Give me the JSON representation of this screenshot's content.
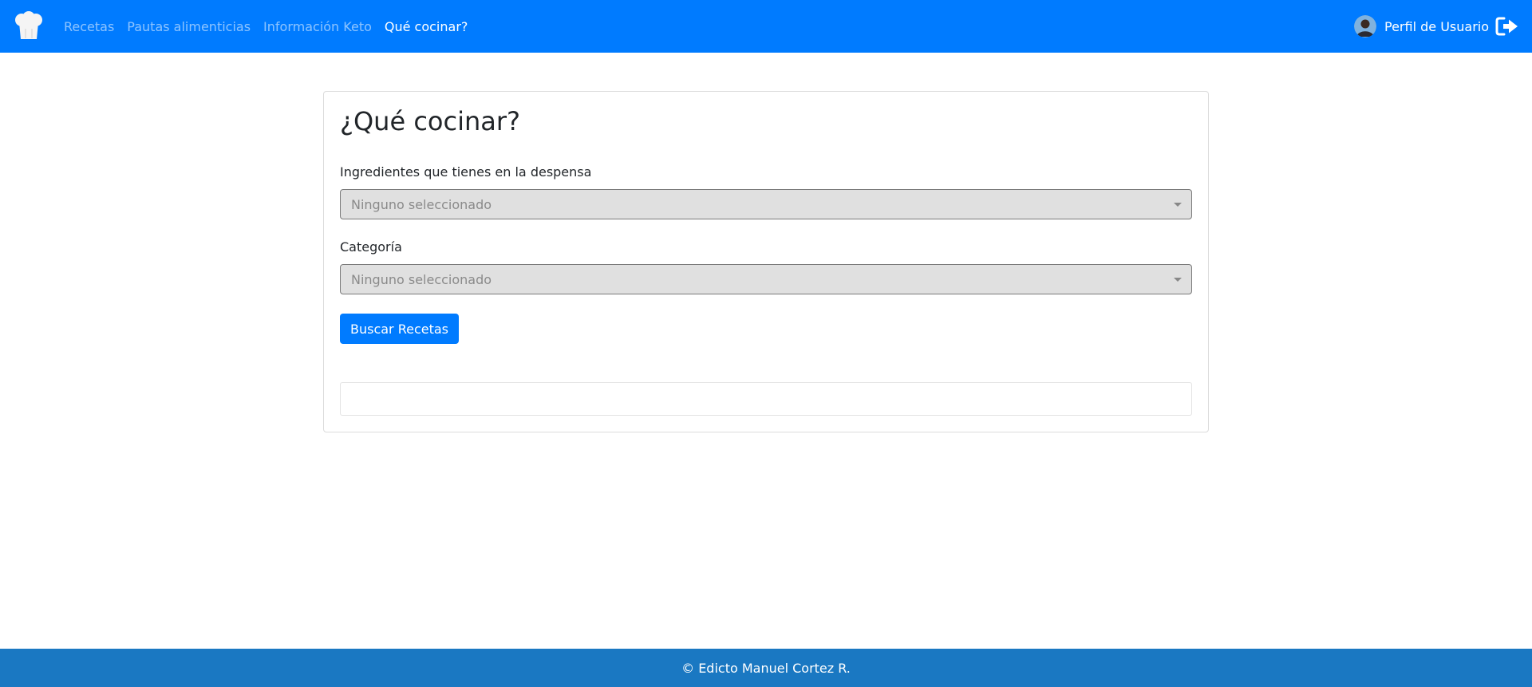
{
  "navbar": {
    "brand_icon": "chef-hat-icon",
    "links": [
      {
        "label": "Recetas"
      },
      {
        "label": "Pautas alimenticias"
      },
      {
        "label": "Información Keto"
      },
      {
        "label": "Qué cocinar?"
      }
    ],
    "active_link": "Qué cocinar?",
    "profile_label": "Perfil de Usuario",
    "logout_icon": "sign-out-icon"
  },
  "card": {
    "title": "¿Qué cocinar?",
    "ingredients": {
      "label": "Ingredientes que tienes en la despensa",
      "value": "Ninguno seleccionado"
    },
    "category": {
      "label": "Categoría",
      "value": "Ninguno seleccionado"
    },
    "search_button": "Buscar Recetas"
  },
  "footer": {
    "text": "© Edicto Manuel Cortez R."
  },
  "colors": {
    "navbar": "#007bff",
    "footer": "#1a78c2",
    "button": "#007bff"
  }
}
